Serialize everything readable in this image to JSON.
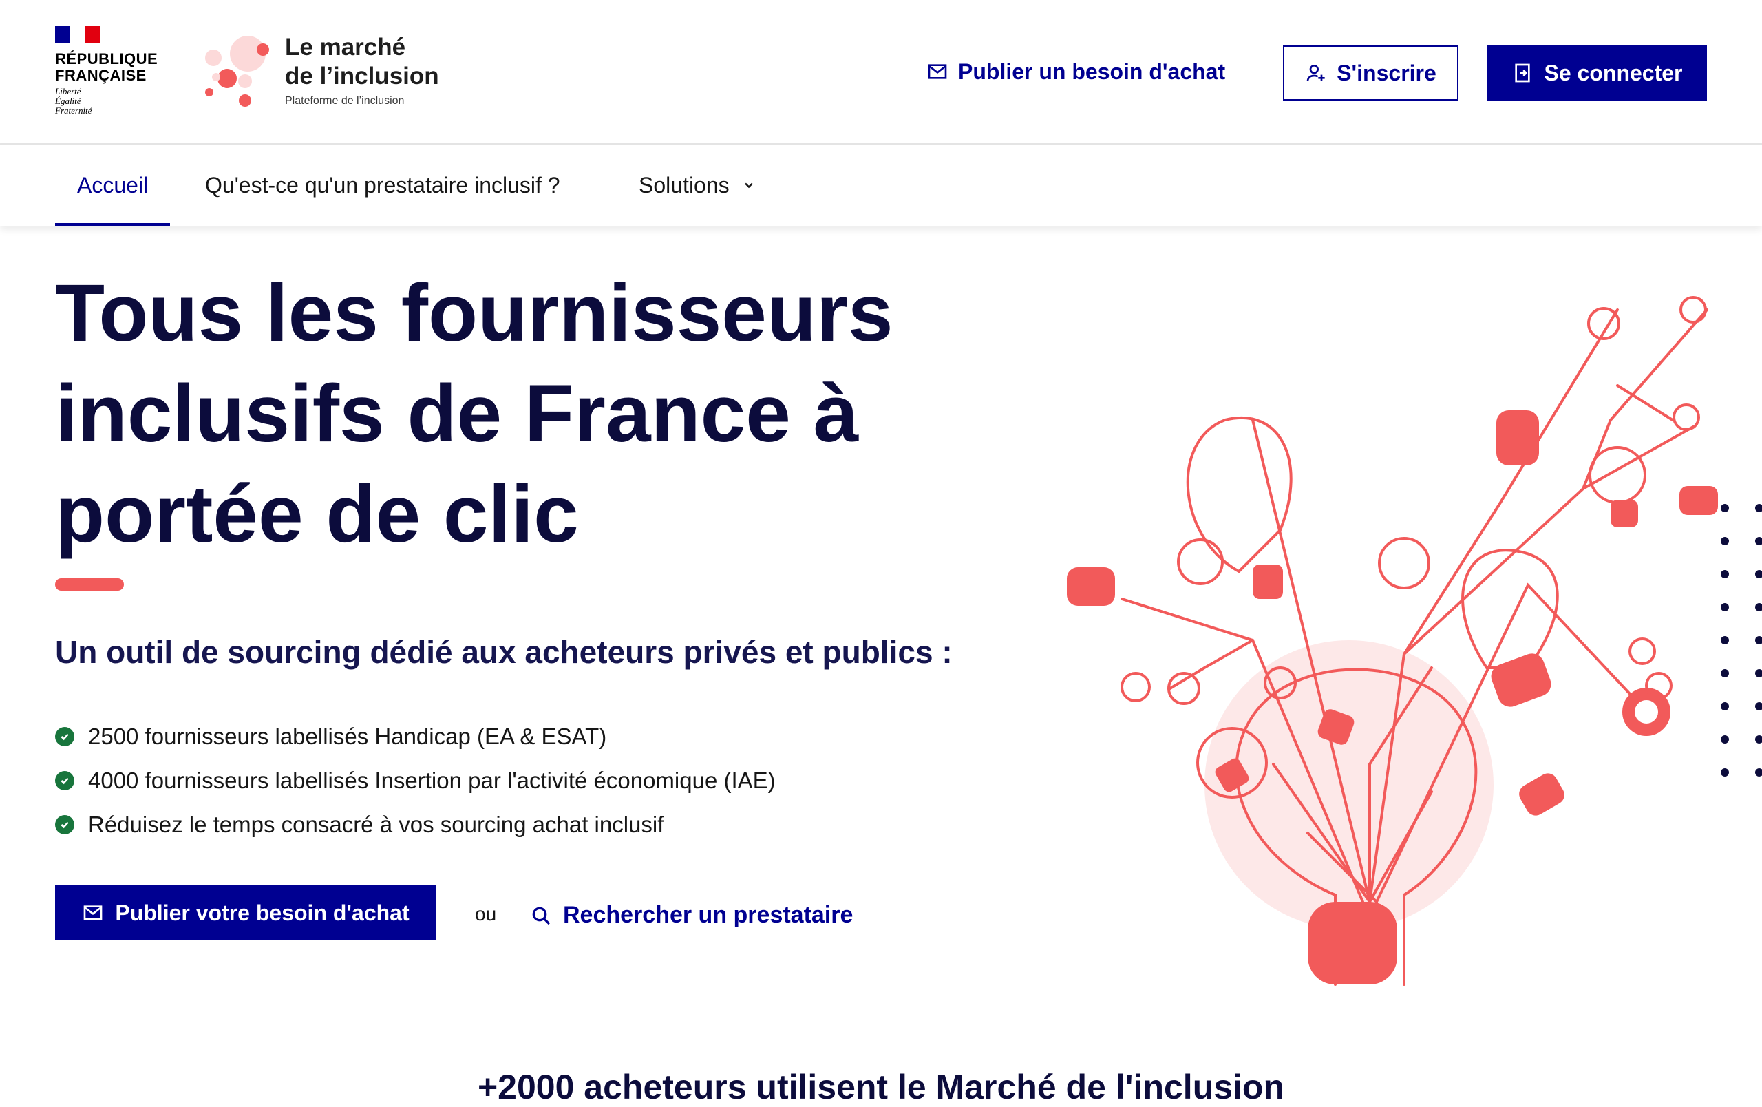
{
  "header": {
    "republic": {
      "line1": "RÉPUBLIQUE",
      "line2": "FRANÇAISE",
      "motto": [
        "Liberté",
        "Égalité",
        "Fraternité"
      ]
    },
    "brand": {
      "line1": "Le marché",
      "line2": "de l’inclusion",
      "subtitle": "Plateforme de l’inclusion"
    },
    "publish_link": "Publier un besoin d'achat",
    "signup_label": "S'inscrire",
    "login_label": "Se connecter"
  },
  "nav": {
    "items": [
      {
        "label": "Accueil",
        "active": true
      },
      {
        "label": "Qu'est-ce qu'un prestataire inclusif ?",
        "active": false
      },
      {
        "label": "Solutions",
        "active": false,
        "has_dropdown": true
      }
    ]
  },
  "hero": {
    "title": "Tous les fournisseurs inclusifs de France à portée de clic",
    "subtitle": "Un outil de sourcing dédié aux acheteurs privés et publics :",
    "features": [
      "2500 fournisseurs labellisés Handicap (EA & ESAT)",
      "4000 fournisseurs labellisés Insertion par l'activité économique (IAE)",
      "Réduisez le temps consacré à vos sourcing achat inclusif"
    ],
    "publish_button": "Publier votre besoin d'achat",
    "or_label": "ou",
    "search_link": "Rechercher un prestataire"
  },
  "stats": {
    "title": "+2000 acheteurs utilisent le Marché de l'inclusion"
  },
  "colors": {
    "primary": "#000091",
    "accent": "#f25a5a",
    "success": "#18753c",
    "title": "#0c0c3c"
  },
  "icons": [
    "mail-send-icon",
    "user-add-icon",
    "login-icon",
    "chevron-down-icon",
    "check-circle-icon",
    "search-icon",
    "lightbulb-illustration"
  ]
}
